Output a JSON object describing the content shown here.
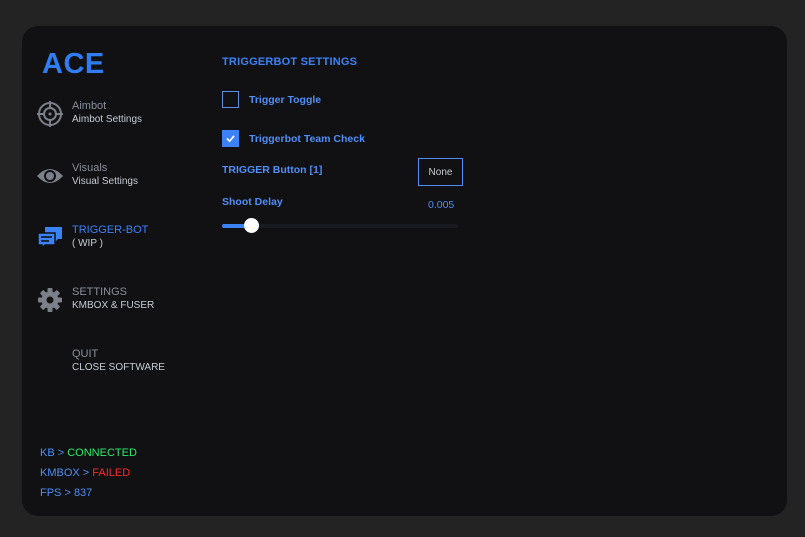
{
  "app": {
    "logo": "ACE"
  },
  "sidebar": {
    "items": [
      {
        "title": "Aimbot",
        "subtitle": "Aimbot Settings",
        "icon": "crosshair-icon"
      },
      {
        "title": "Visuals",
        "subtitle": "Visual Settings",
        "icon": "eye-icon"
      },
      {
        "title": "TRIGGER-BOT",
        "subtitle": "( WIP )",
        "icon": "chat-bubbles-icon",
        "active": true
      },
      {
        "title": "SETTINGS",
        "subtitle": "KMBOX & FUSER",
        "icon": "gear-icon"
      },
      {
        "title": "QUIT",
        "subtitle": "CLOSE SOFTWARE",
        "icon": ""
      }
    ]
  },
  "status": {
    "kb_label": "KB > ",
    "kb_value": "CONNECTED",
    "kmbox_label": "KMBOX > ",
    "kmbox_value": "FAILED",
    "fps_label": "FPS > ",
    "fps_value": "837"
  },
  "main": {
    "section_title": "TRIGGERBOT SETTINGS",
    "trigger_toggle": {
      "label": "Trigger Toggle",
      "checked": false
    },
    "team_check": {
      "label": "Triggerbot Team Check",
      "checked": true
    },
    "trigger_button": {
      "label": "TRIGGER Button [1]",
      "value": "None"
    },
    "shoot_delay": {
      "label": "Shoot Delay",
      "value": "0.005",
      "fill_fraction": 0.1
    }
  },
  "colors": {
    "accent": "#3b82f6",
    "ok": "#2ee86a",
    "bad": "#ff2a2a",
    "panel": "#111114",
    "bg": "#232323"
  }
}
